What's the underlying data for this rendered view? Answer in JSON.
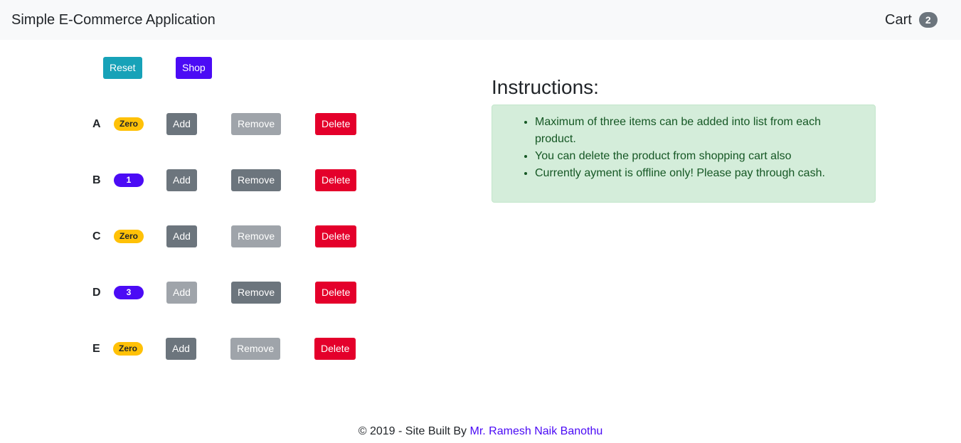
{
  "navbar": {
    "brand": "Simple E-Commerce Application",
    "cart_label": "Cart",
    "cart_count": "2"
  },
  "toolbar": {
    "reset_label": "Reset",
    "shop_label": "Shop"
  },
  "products": [
    {
      "name": "A",
      "qty": "Zero",
      "add": "Add",
      "remove": "Remove",
      "delete": "Delete"
    },
    {
      "name": "B",
      "qty": "1",
      "add": "Add",
      "remove": "Remove",
      "delete": "Delete"
    },
    {
      "name": "C",
      "qty": "Zero",
      "add": "Add",
      "remove": "Remove",
      "delete": "Delete"
    },
    {
      "name": "D",
      "qty": "3",
      "add": "Add",
      "remove": "Remove",
      "delete": "Delete"
    },
    {
      "name": "E",
      "qty": "Zero",
      "add": "Add",
      "remove": "Remove",
      "delete": "Delete"
    }
  ],
  "instructions": {
    "title": "Instructions:",
    "items": [
      "Maximum of three items can be added into list from each product.",
      "You can delete the product from shopping cart also",
      "Currently ayment is offline only! Please pay through cash."
    ]
  },
  "footer": {
    "text": "© 2019 - Site Built By ",
    "author": "Mr. Ramesh Naik Banothu"
  },
  "colors": {
    "reset": "#17a2b8",
    "shop": "#4b0bf5",
    "secondary": "#6c757d",
    "danger": "#e4002b",
    "warning": "#ffc107",
    "alert_bg": "#d4edda",
    "alert_text": "#155724"
  }
}
